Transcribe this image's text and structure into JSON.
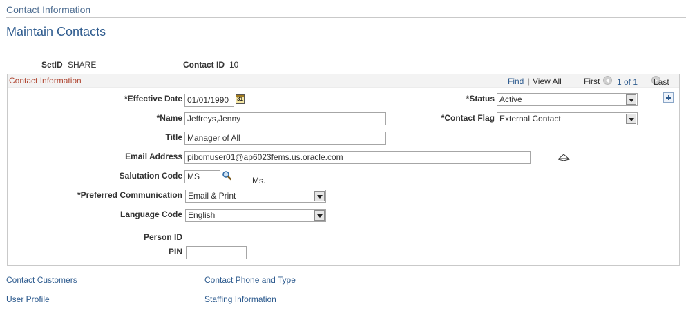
{
  "breadcrumb": "Contact Information",
  "page_title": "Maintain Contacts",
  "header": {
    "setid_label": "SetID",
    "setid_value": "SHARE",
    "contact_id_label": "Contact ID",
    "contact_id_value": "10"
  },
  "section": {
    "title": "Contact Information",
    "find": "Find",
    "separator": "|",
    "view_all": "View All",
    "first": "First",
    "page_of": "1 of 1",
    "last": "Last"
  },
  "form": {
    "effective_date": {
      "label": "*Effective Date",
      "value": "01/01/1990"
    },
    "status": {
      "label": "*Status",
      "value": "Active"
    },
    "name": {
      "label": "*Name",
      "value": "Jeffreys,Jenny"
    },
    "contact_flag": {
      "label": "*Contact Flag",
      "value": "External Contact"
    },
    "title": {
      "label": "Title",
      "value": "Manager of All"
    },
    "email": {
      "label": "Email Address",
      "value": "pibomuser01@ap6023fems.us.oracle.com"
    },
    "salutation": {
      "label": "Salutation Code",
      "value": "MS",
      "description": "Ms."
    },
    "preferred_comm": {
      "label": "*Preferred Communication",
      "value": "Email & Print"
    },
    "language": {
      "label": "Language Code",
      "value": "English"
    },
    "person_id": {
      "label": "Person ID"
    },
    "pin": {
      "label": "PIN",
      "value": ""
    }
  },
  "links": {
    "contact_customers": "Contact Customers",
    "contact_phone": "Contact Phone and Type",
    "user_profile": "User Profile",
    "staffing": "Staffing Information"
  },
  "icons": {
    "calendar": "calendar-icon",
    "lookup": "search-icon",
    "add_row": "plus-icon",
    "prev": "chevron-left-icon",
    "next": "chevron-right-icon",
    "dropdown": "chevron-down-icon"
  },
  "colors": {
    "link": "#2f5c8f",
    "section_title": "#b04733",
    "page_title": "#2f5c8f"
  }
}
